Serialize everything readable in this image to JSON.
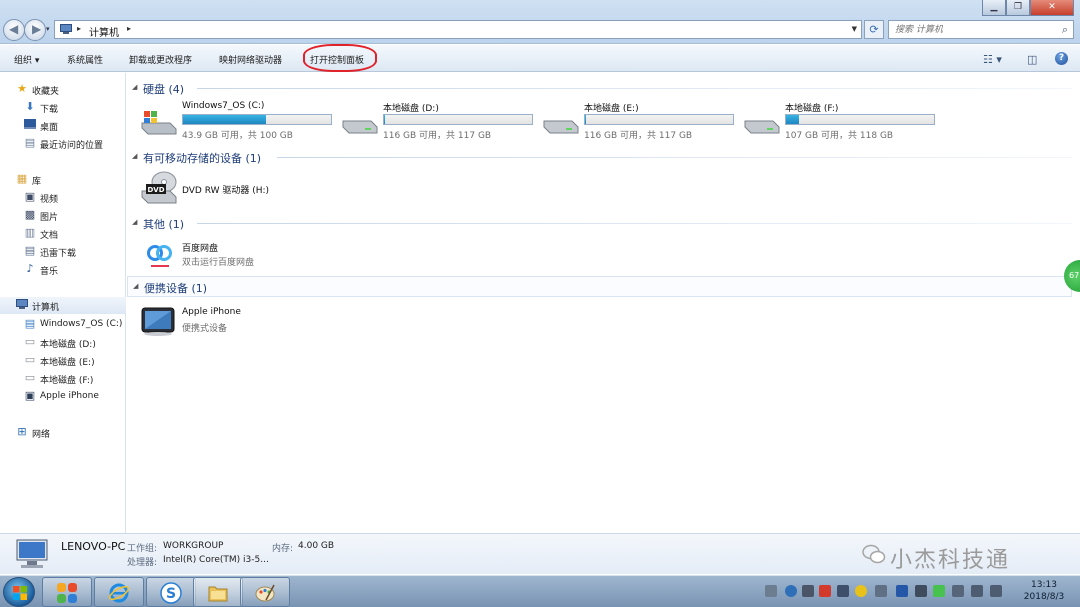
{
  "window": {
    "breadcrumb": "计算机",
    "search_placeholder": "搜索 计算机"
  },
  "toolbar": {
    "organize": "组织 ▾",
    "system_properties": "系统属性",
    "uninstall": "卸载或更改程序",
    "map_drive": "映射网络驱动器",
    "control_panel": "打开控制面板"
  },
  "nav": {
    "favorites": "收藏夹",
    "downloads": "下载",
    "desktop": "桌面",
    "recent": "最近访问的位置",
    "libraries": "库",
    "videos": "视频",
    "pictures": "图片",
    "documents": "文档",
    "thunder": "迅雷下载",
    "music": "音乐",
    "computer": "计算机",
    "drive_c": "Windows7_OS (C:)",
    "drive_d": "本地磁盘 (D:)",
    "drive_e": "本地磁盘 (E:)",
    "drive_f": "本地磁盘 (F:)",
    "iphone": "Apple iPhone",
    "network": "网络"
  },
  "groups": {
    "hard_disks": "硬盘 (4)",
    "removable": "有可移动存储的设备 (1)",
    "other": "其他 (1)",
    "portable": "便携设备 (1)"
  },
  "drives": [
    {
      "name": "Windows7_OS (C:)",
      "info": "43.9 GB 可用，共 100 GB",
      "used_fraction": 0.56
    },
    {
      "name": "本地磁盘 (D:)",
      "info": "116 GB 可用，共 117 GB",
      "used_fraction": 0.01
    },
    {
      "name": "本地磁盘 (E:)",
      "info": "116 GB 可用，共 117 GB",
      "used_fraction": 0.01
    },
    {
      "name": "本地磁盘 (F:)",
      "info": "107 GB 可用，共 118 GB",
      "used_fraction": 0.09
    }
  ],
  "dvd": {
    "name": "DVD RW 驱动器 (H:)",
    "label": "DVD"
  },
  "baidu": {
    "name": "百度网盘",
    "sub": "双击运行百度网盘"
  },
  "iphone": {
    "name": "Apple iPhone",
    "sub": "便携式设备"
  },
  "details": {
    "pc_name": "LENOVO-PC",
    "workgroup_label": "工作组:",
    "workgroup": "WORKGROUP",
    "memory_label": "内存:",
    "memory": "4.00 GB",
    "cpu_label": "处理器:",
    "cpu": "Intel(R) Core(TM) i3-5..."
  },
  "watermark": "小杰科技通",
  "side_badge": "67",
  "clock": {
    "time": "13:13",
    "date": "2018/8/3"
  },
  "colors": {
    "accent": "#1e86c0",
    "highlight_circle": "#e0232a"
  }
}
